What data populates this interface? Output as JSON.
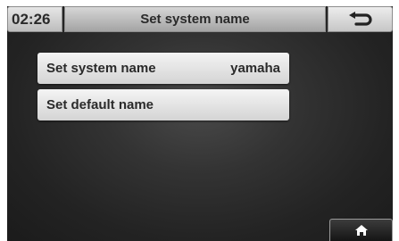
{
  "header": {
    "time": "02:26",
    "title": "Set system name",
    "back_icon": "back-arrow-icon"
  },
  "menu": {
    "items": [
      {
        "label": "Set system name",
        "value": "yamaha"
      },
      {
        "label": "Set default name"
      }
    ]
  },
  "footer": {
    "home_icon": "home-icon"
  },
  "colors": {
    "background": "#262626",
    "button_face": "#e6e6e6",
    "text": "#2a2a2a"
  }
}
